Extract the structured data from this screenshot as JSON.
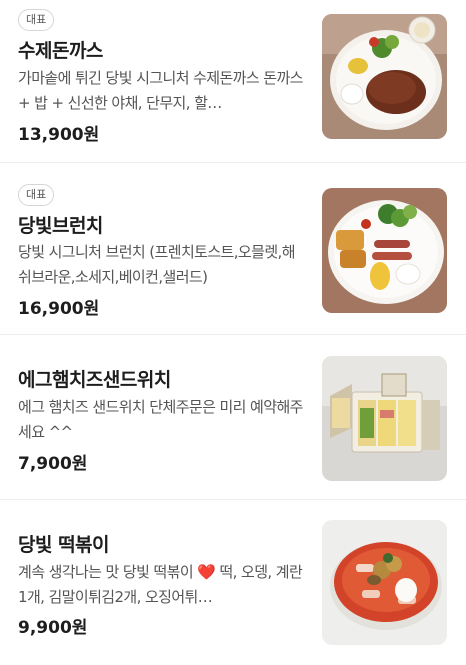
{
  "items": [
    {
      "badge": "대표",
      "name": "수제돈까스",
      "desc": "가마솥에 튀긴 당빛 시그니처 수제돈까스 돈까스 + 밥 + 신선한 야채, 단무지, 할…",
      "price": "13,900원"
    },
    {
      "badge": "대표",
      "name": "당빛브런치",
      "desc": "당빛 시그니처 브런치 (프렌치토스트,오믈렛,해쉬브라운,소세지,베이컨,샐러드)",
      "price": "16,900원"
    },
    {
      "name": "에그햄치즈샌드위치",
      "desc": "에그 햄치즈 샌드위치 단체주문은 미리 예약해주세요 ^^",
      "price": "7,900원"
    },
    {
      "name": "당빛 떡볶이",
      "desc": "계속 생각나는 맛 당빛 떡볶이 ❤️ 떡, 오뎅, 계란1개, 김말이튀김2개, 오징어튀…",
      "price": "9,900원"
    }
  ]
}
